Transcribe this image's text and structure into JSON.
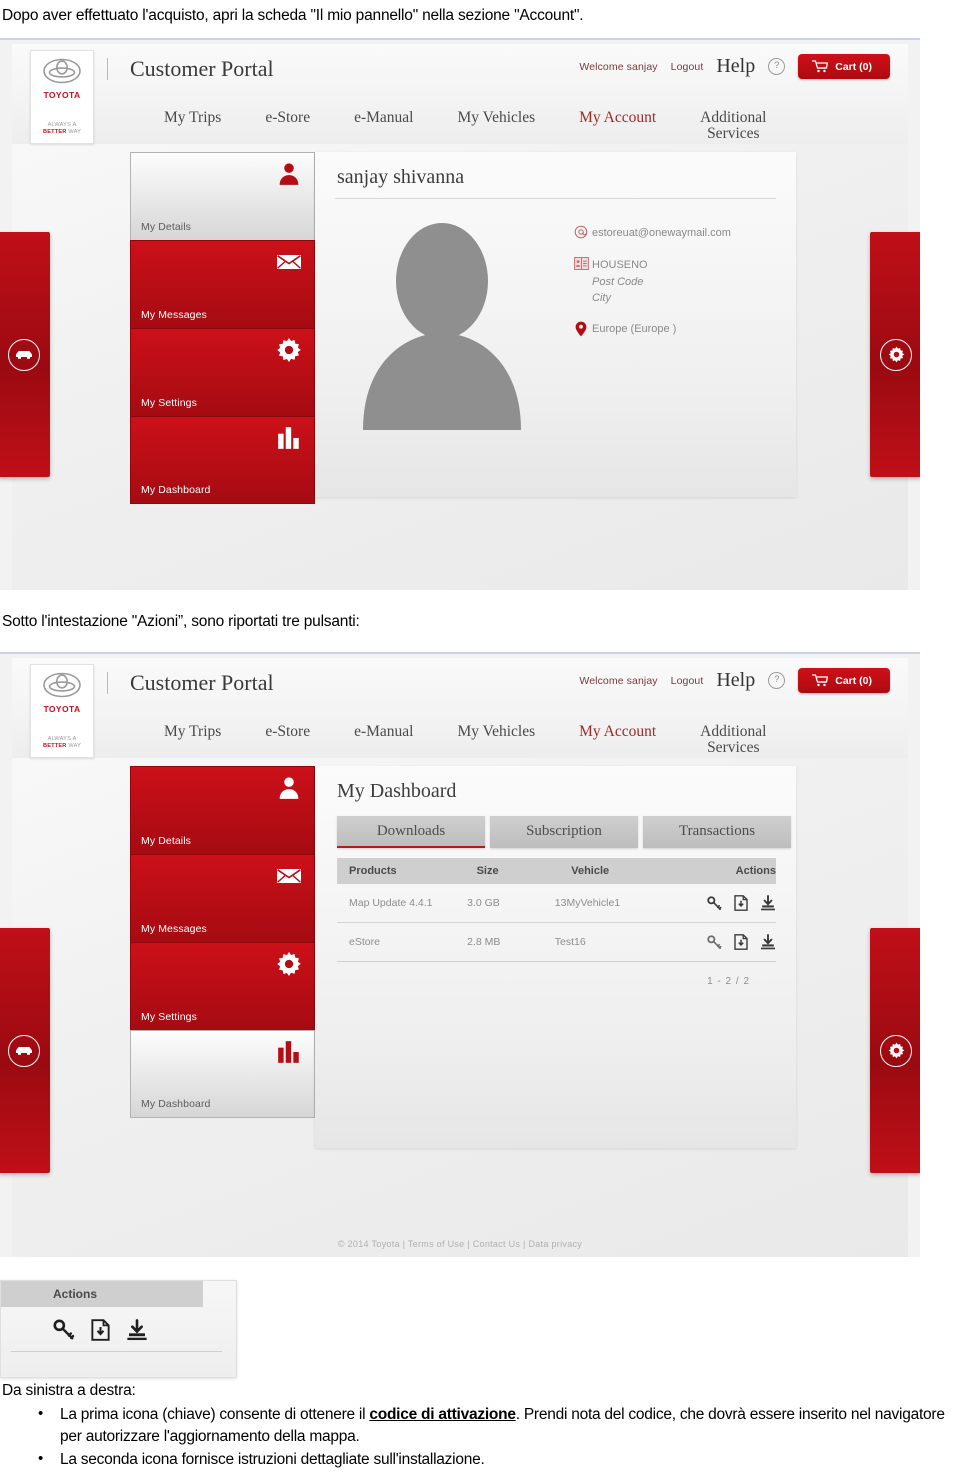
{
  "doc": {
    "intro": "Dopo aver effettuato l'acquisto, apri la scheda \"Il mio pannello\" nella sezione \"Account\".",
    "middle": "Sotto l'intestazione \"Azioni”, sono riportati tre pulsanti:",
    "bottom_lead": "Da sinistra a destra:",
    "bullet1_part1": "La prima icona (chiave) consente di ottenere il ",
    "bullet1_bold": "codice di attivazione",
    "bullet1_part2": ". Prendi nota del codice, che dovrà essere inserito nel navigatore per autorizzare l'aggiornamento della mappa.",
    "bullet2": "La seconda icona fornisce istruzioni dettagliate sull'installazione."
  },
  "colors": {
    "brand_red": "#cc1019",
    "dark_red": "#a50b12",
    "accent_underline": "#b51a1a",
    "muted_text": "#8a8a8a"
  },
  "portal": {
    "logo": {
      "word": "TOYOTA",
      "tagline_line1": "ALWAYS A",
      "tagline_bold": "BETTER",
      "tagline_line2": "WAY",
      "icon": "toyota-emblem-icon"
    },
    "title": "Customer Portal",
    "account_links": {
      "welcome": "Welcome sanjay",
      "logout": "Logout",
      "help": "Help",
      "help_icon": "question-mark-circle-icon",
      "cart_label": "Cart (0)",
      "cart_icon": "shopping-cart-icon"
    },
    "nav": [
      {
        "label": "My Trips",
        "active": false
      },
      {
        "label": "e-Store",
        "active": false
      },
      {
        "label": "e-Manual",
        "active": false
      },
      {
        "label": "My Vehicles",
        "active": false
      },
      {
        "label": "My Account",
        "active": true
      },
      {
        "label": "Additional Services",
        "active": false
      }
    ],
    "side_tabs": {
      "left_icon": "car-circle-icon",
      "right_icon": "gear-circle-icon"
    },
    "account_menu": [
      {
        "label": "My Details",
        "icon": "person-icon"
      },
      {
        "label": "My Messages",
        "icon": "envelope-icon"
      },
      {
        "label": "My Settings",
        "icon": "gear-icon"
      },
      {
        "label": "My Dashboard",
        "icon": "bar-chart-icon"
      }
    ],
    "footer": "© 2014 Toyota | Terms of Use | Contact Us | Data privacy"
  },
  "screenshot1": {
    "active_menu_index": 0,
    "profile": {
      "name": "sanjay shivanna",
      "avatar_icon": "person-silhouette-icon",
      "email_icon": "at-sign-icon",
      "email": "estoreuat@onewaymail.com",
      "address_icon": "address-book-icon",
      "address_line1": "HOUSENO",
      "address_line2": "Post Code",
      "address_line3": "City",
      "location_icon": "map-pin-icon",
      "location": "Europe (Europe )"
    }
  },
  "screenshot2": {
    "active_menu_index": 3,
    "title": "My Dashboard",
    "tabs": [
      {
        "label": "Downloads",
        "active": true
      },
      {
        "label": "Subscription",
        "active": false
      },
      {
        "label": "Transactions",
        "active": false
      }
    ],
    "table": {
      "headers": [
        "Products",
        "Size",
        "Vehicle",
        "Actions"
      ],
      "rows": [
        {
          "product": "Map Update 4.4.1",
          "size": "3.0 GB",
          "vehicle": "13MyVehicle1"
        },
        {
          "product": "eStore",
          "size": "2.8 MB",
          "vehicle": "Test16"
        }
      ],
      "row_action_icons": [
        "key-icon",
        "document-download-icon",
        "install-icon"
      ],
      "pagination": "1 - 2 / 2"
    }
  },
  "zoom_callout": {
    "header": "Actions",
    "icons": [
      "key-icon",
      "document-download-icon",
      "install-icon"
    ]
  }
}
